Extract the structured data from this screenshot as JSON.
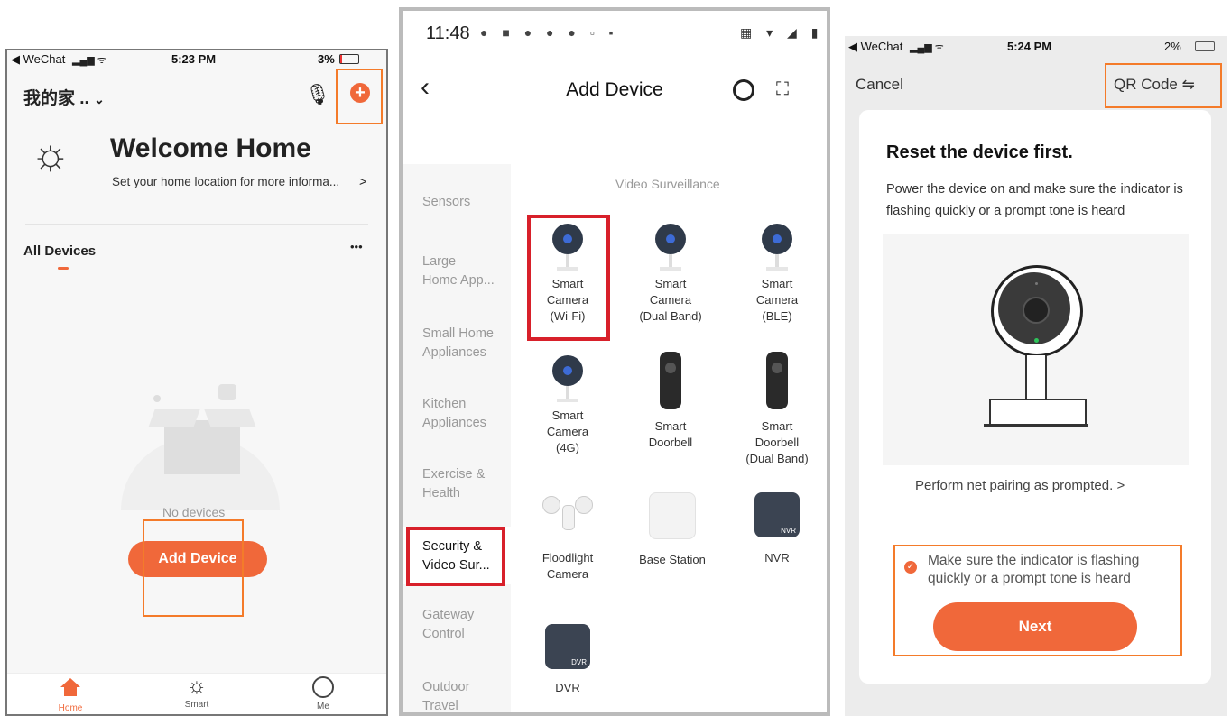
{
  "panel1": {
    "status": {
      "carrier": "◀ WeChat",
      "time": "5:23 PM",
      "battery": "3%"
    },
    "home_title": "我的家 ..",
    "welcome_title": "Welcome Home",
    "welcome_sub": "Set your home location for more informa...",
    "all_devices": "All Devices",
    "more": "•••",
    "no_devices": "No devices",
    "add_device": "Add Device",
    "tabs": [
      {
        "label": "Home"
      },
      {
        "label": "Smart"
      },
      {
        "label": "Me"
      }
    ]
  },
  "panel2": {
    "status": {
      "time": "11:48"
    },
    "title": "Add Device",
    "categories": [
      {
        "label": "Sensors"
      },
      {
        "label": "Large\nHome App..."
      },
      {
        "label": "Small Home\nAppliances"
      },
      {
        "label": "Kitchen\nAppliances"
      },
      {
        "label": "Exercise &\nHealth"
      },
      {
        "label": "Security &\nVideo Sur..."
      },
      {
        "label": "Gateway\nControl"
      },
      {
        "label": "Outdoor\nTravel"
      }
    ],
    "section_title": "Video Surveillance",
    "devices": [
      {
        "label": "Smart\nCamera\n(Wi-Fi)"
      },
      {
        "label": "Smart\nCamera\n(Dual Band)"
      },
      {
        "label": "Smart\nCamera\n(BLE)"
      },
      {
        "label": "Smart\nCamera\n(4G)"
      },
      {
        "label": "Smart\nDoorbell"
      },
      {
        "label": "Smart\nDoorbell\n(Dual Band)"
      },
      {
        "label": "Floodlight\nCamera"
      },
      {
        "label": "Base Station"
      },
      {
        "label": "NVR"
      },
      {
        "label": "DVR"
      }
    ],
    "nvr_tag": "NVR",
    "dvr_tag": "DVR"
  },
  "panel3": {
    "status": {
      "carrier": "◀ WeChat",
      "time": "5:24 PM",
      "battery": "2%"
    },
    "cancel": "Cancel",
    "qr_code": "QR Code ⇋",
    "reset_title": "Reset the device first.",
    "reset_desc": "Power the device on and make sure the indicator is flashing quickly or a prompt tone is heard",
    "pairing_link": "Perform net pairing as prompted. >",
    "confirm_text": "Make sure the indicator is flashing quickly or a prompt tone is heard",
    "next": "Next"
  },
  "colors": {
    "accent": "#f0683a",
    "highlight_orange": "#f47b2a",
    "highlight_red": "#d8202a"
  }
}
